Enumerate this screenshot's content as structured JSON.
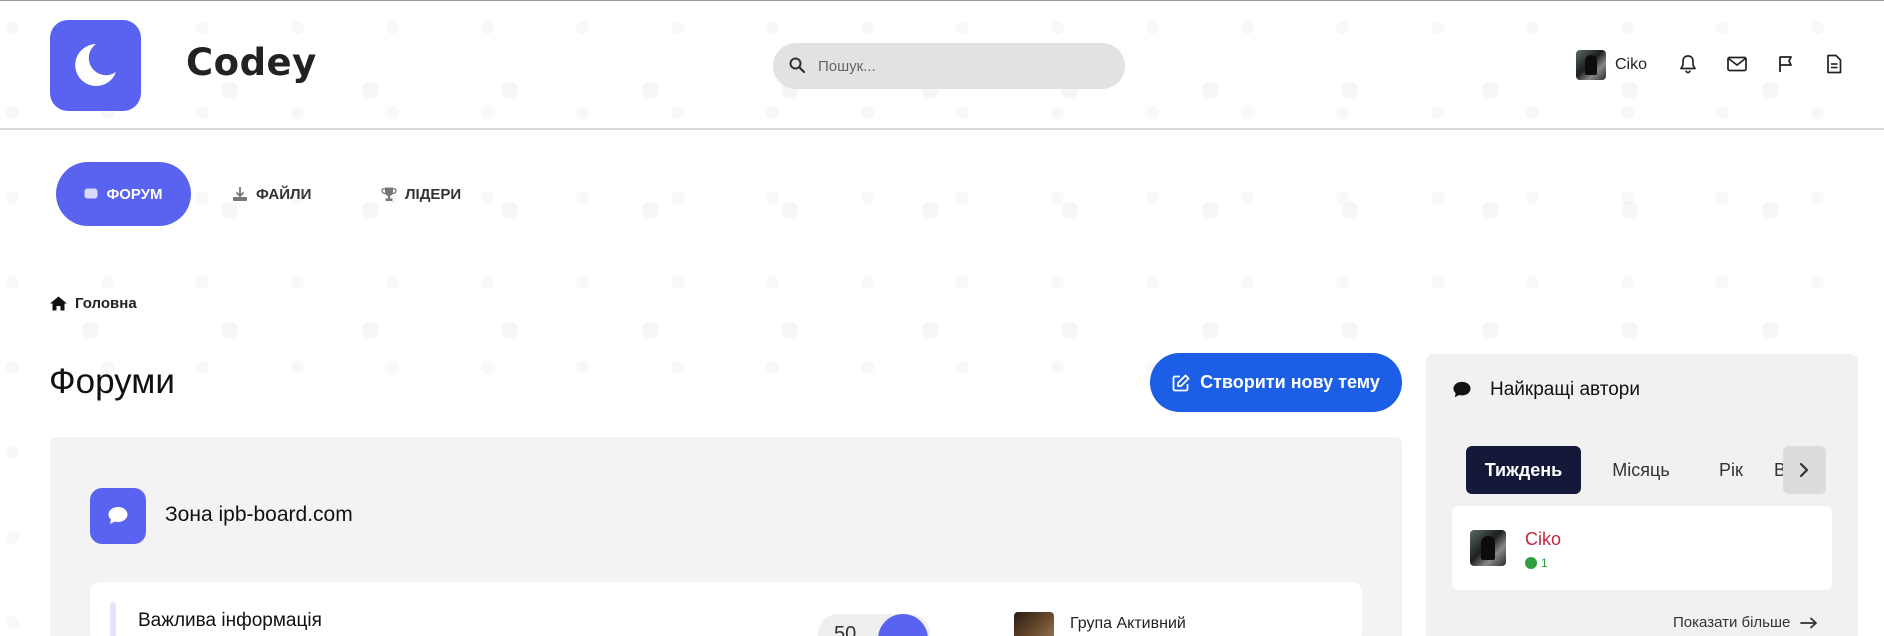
{
  "header": {
    "brand": "Codey",
    "search_placeholder": "Пошук...",
    "user_name": "Ciko"
  },
  "nav": {
    "forum": "ФОРУМ",
    "files": "ФАЙЛИ",
    "leaders": "ЛІДЕРИ"
  },
  "breadcrumb": {
    "home": "Головна"
  },
  "main": {
    "title": "Форуми",
    "new_topic": "Створити нову тему",
    "category": "Зона ipb-board.com",
    "forum_row": {
      "title": "Важлива інформація",
      "stat": "50",
      "last_group": "Група Активний"
    }
  },
  "sidebar": {
    "title": "Найкращі автори",
    "tabs": [
      "Тиждень",
      "Місяць",
      "Рік",
      "В"
    ],
    "author": {
      "name": "Ciko",
      "reputation": "1"
    },
    "show_more": "Показати більше"
  },
  "colors": {
    "accent": "#5a63f0",
    "primary_button": "#1c5ee6",
    "tab_active": "#14193a",
    "author_name": "#c1283e",
    "reputation": "#2e9e3e"
  }
}
